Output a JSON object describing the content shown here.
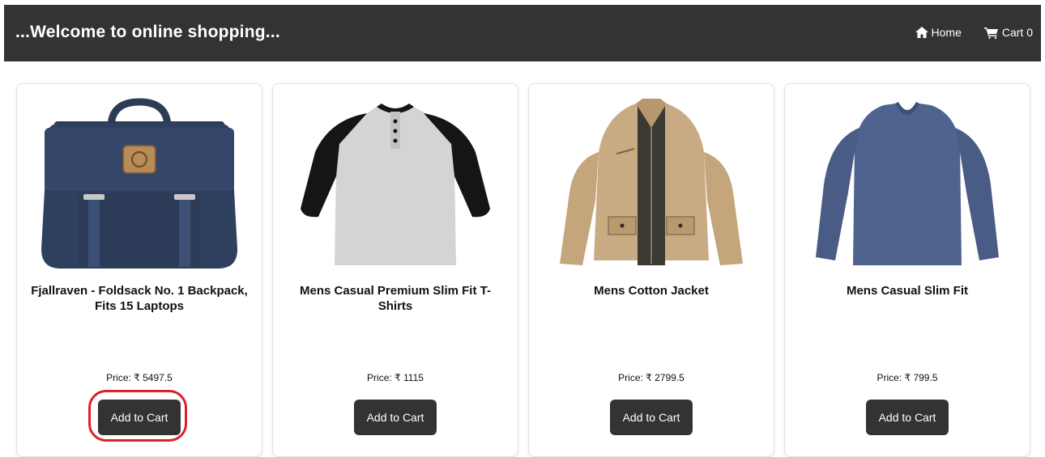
{
  "header": {
    "title": "...Welcome to online shopping...",
    "nav": [
      {
        "label": "Home",
        "icon": "home-icon"
      },
      {
        "label": "Cart 0",
        "icon": "cart-icon"
      }
    ]
  },
  "products": [
    {
      "title": "Fjallraven - Foldsack No. 1 Backpack, Fits 15 Laptops",
      "price": "Price: ₹ 5497.5",
      "button": "Add to Cart",
      "image": "navy-backpack-image",
      "highlighted": true
    },
    {
      "title": "Mens Casual Premium Slim Fit T-Shirts",
      "price": "Price: ₹ 1115",
      "button": "Add to Cart",
      "image": "raglan-tshirt-image",
      "highlighted": false
    },
    {
      "title": "Mens Cotton Jacket",
      "price": "Price: ₹ 2799.5",
      "button": "Add to Cart",
      "image": "khaki-jacket-image",
      "highlighted": false
    },
    {
      "title": "Mens Casual Slim Fit",
      "price": "Price: ₹ 799.5",
      "button": "Add to Cart",
      "image": "blue-longsleeve-image",
      "highlighted": false
    }
  ],
  "colors": {
    "header_bg": "#333333",
    "button_bg": "#333333",
    "highlight_ring": "#d8232a"
  }
}
